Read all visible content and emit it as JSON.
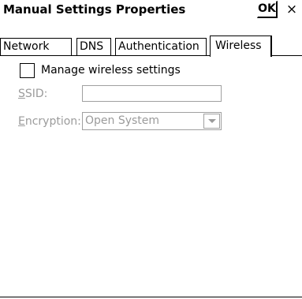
{
  "window": {
    "title": "Manual Settings Properties",
    "ok_label": "OK",
    "close_label": "×"
  },
  "tabs": [
    {
      "label": "Network",
      "active": false
    },
    {
      "label": "DNS",
      "active": false
    },
    {
      "label": "Authentication",
      "active": false
    },
    {
      "label": "Wireless",
      "active": true
    }
  ],
  "wireless": {
    "manage_label": "Manage wireless settings",
    "manage_checked": false,
    "ssid_label_accel": "S",
    "ssid_label_rest": "SID:",
    "ssid_value": "",
    "encryption_label_accel": "E",
    "encryption_label_rest": "ncryption:",
    "encryption_value": "Open System",
    "enabled": false
  },
  "icons": {
    "close": "close-icon",
    "dropdown": "chevron-down-icon"
  },
  "colors": {
    "disabled_text": "#9b9b9b",
    "border": "#000000"
  }
}
